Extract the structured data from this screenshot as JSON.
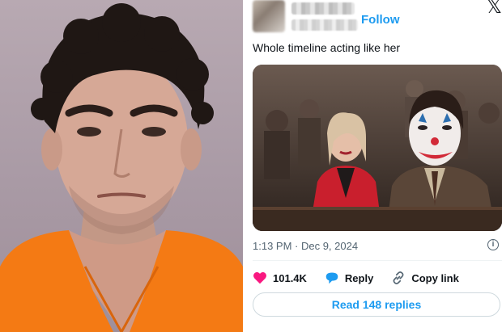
{
  "tweet": {
    "follow_label": "Follow",
    "x_logo": "𝕏",
    "text": "Whole timeline acting like her",
    "timestamp": "1:13 PM · Dec 9, 2024",
    "likes": "101.4K",
    "reply_label": "Reply",
    "copy_link_label": "Copy link",
    "read_replies_label": "Read 148 replies",
    "icons": {
      "info": "info-icon",
      "like": "heart-icon",
      "reply": "speech-bubble-icon",
      "copy_link": "link-icon"
    }
  },
  "colors": {
    "accent": "#1d9bf0",
    "like": "#f91880",
    "jumpsuit": "#f47a14",
    "lipstick": "#d22a38",
    "jacket_red": "#c91f2d"
  }
}
